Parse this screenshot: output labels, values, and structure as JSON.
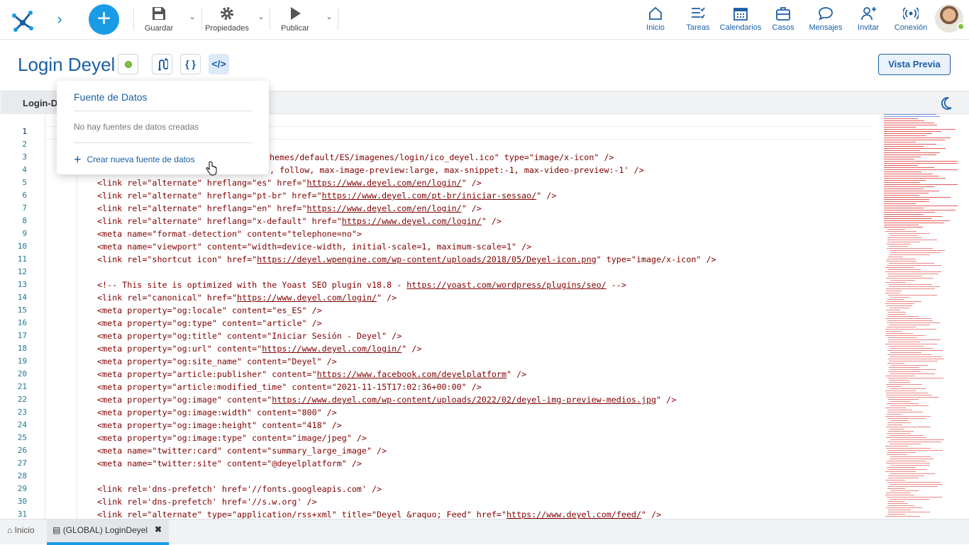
{
  "toolbar": {
    "guardar": "Guardar",
    "propiedades": "Propiedades",
    "publicar": "Publicar"
  },
  "nav": {
    "inicio": "Inicio",
    "tareas": "Tareas",
    "calendarios": "Calendarios",
    "casos": "Casos",
    "mensajes": "Mensajes",
    "invitar": "Invitar",
    "conexion": "Conexión"
  },
  "page": {
    "title": "Login Deyel",
    "preview_label": "Vista Previa",
    "tab_label": "Login-D"
  },
  "popup": {
    "title": "Fuente de Datos",
    "empty_text": "No hay fuentes de datos creadas",
    "create_label": "Crear nueva fuente de datos"
  },
  "editor": {
    "line_numbers": [
      "1",
      "2",
      "3",
      "4",
      "5",
      "6",
      "7",
      "8",
      "9",
      "10",
      "11",
      "12",
      "13",
      "14",
      "15",
      "16",
      "17",
      "18",
      "19",
      "20",
      "21",
      "22",
      "23",
      "24",
      "25",
      "26",
      "27",
      "28",
      "29",
      "30",
      "31"
    ],
    "lines": [
      "",
      "",
      "hemes/default/ES/imagenes/login/ico_deyel.ico\" type=\"image/x-icon\" />",
      ", follow, max-image-preview:large, max-snippet:-1, max-video-preview:-1' />",
      "<link rel=\"alternate\" hreflang=\"es\" href=\"https://www.deyel.com/en/login/\" />",
      "<link rel=\"alternate\" hreflang=\"pt-br\" href=\"https://www.deyel.com/pt-br/iniciar-sessao/\" />",
      "<link rel=\"alternate\" hreflang=\"en\" href=\"https://www.deyel.com/en/login/\" />",
      "<link rel=\"alternate\" hreflang=\"x-default\" href=\"https://www.deyel.com/login/\" />",
      "<meta name=\"format-detection\" content=\"telephone=no\">",
      "<meta name=\"viewport\" content=\"width=device-width, initial-scale=1, maximum-scale=1\" />",
      "<link rel=\"shortcut icon\" href=\"https://deyel.wpengine.com/wp-content/uploads/2018/05/Deyel-icon.png\" type=\"image/x-icon\" />",
      "",
      "<!-- This site is optimized with the Yoast SEO plugin v18.8 - https://yoast.com/wordpress/plugins/seo/ -->",
      "<link rel=\"canonical\" href=\"https://www.deyel.com/login/\" />",
      "<meta property=\"og:locale\" content=\"es_ES\" />",
      "<meta property=\"og:type\" content=\"article\" />",
      "<meta property=\"og:title\" content=\"Iniciar Sesión - Deyel\" />",
      "<meta property=\"og:url\" content=\"https://www.deyel.com/login/\" />",
      "<meta property=\"og:site_name\" content=\"Deyel\" />",
      "<meta property=\"article:publisher\" content=\"https://www.facebook.com/deyelplatform\" />",
      "<meta property=\"article:modified_time\" content=\"2021-11-15T17:02:36+00:00\" />",
      "<meta property=\"og:image\" content=\"https://www.deyel.com/wp-content/uploads/2022/02/deyel-img-preview-medios.jpg\" />",
      "<meta property=\"og:image:width\" content=\"800\" />",
      "<meta property=\"og:image:height\" content=\"418\" />",
      "<meta property=\"og:image:type\" content=\"image/jpeg\" />",
      "<meta name=\"twitter:card\" content=\"summary_large_image\" />",
      "<meta name=\"twitter:site\" content=\"@deyelplatform\" />",
      "",
      "<link rel='dns-prefetch' href='//fonts.googleapis.com' />",
      "<link rel='dns-prefetch' href='//s.w.org' />",
      "<link rel=\"alternate\" type=\"application/rss+xml\" title=\"Deyel &raquo; Feed\" href=\"https://www.deyel.com/feed/\" />"
    ]
  },
  "bottom": {
    "home_label": "Inicio",
    "tab_label": "(GLOBAL) LoginDeyel",
    "close_glyph": "✖"
  },
  "colors": {
    "accent": "#1a9be6",
    "brand": "#1b5fa5",
    "code": "#800000",
    "line_number": "#237893",
    "status_ok": "#7ec242"
  }
}
